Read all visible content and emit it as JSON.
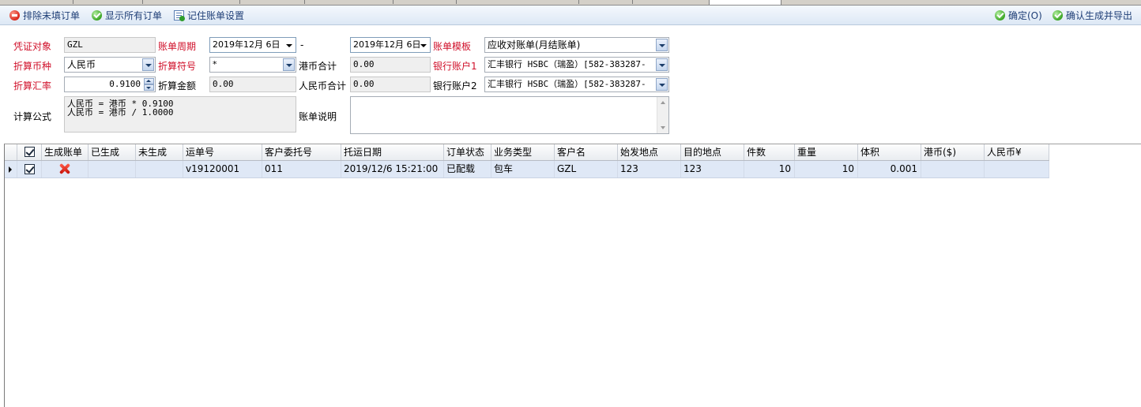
{
  "toolbar": {
    "exclude_unfilled_label": "排除未填订单",
    "show_all_label": "显示所有订单",
    "remember_settings_label": "记住账单设置",
    "ok_label": "确定(O)",
    "confirm_export_label": "确认生成并导出"
  },
  "form": {
    "voucher_target_label": "凭证对象",
    "voucher_target_value": "GZL",
    "bill_period_label": "账单周期",
    "period_start": "2019年12月 6日",
    "period_separator": "-",
    "period_end": "2019年12月 6日",
    "bill_template_label": "账单模板",
    "bill_template_value": "应收对账单(月结账单)",
    "conv_currency_label": "折算币种",
    "conv_currency_value": "人民币",
    "conv_symbol_label": "折算符号",
    "conv_symbol_value": "*",
    "hkd_total_label": "港币合计",
    "hkd_total_value": "0.00",
    "bank_account1_label": "银行账户1",
    "bank_account1_value": "汇丰银行 HSBC（瑞盈）[582-383287-",
    "conv_rate_label": "折算汇率",
    "conv_rate_value": "0.9100",
    "conv_amount_label": "折算金额",
    "conv_amount_value": "0.00",
    "rmb_total_label": "人民币合计",
    "rmb_total_value": "0.00",
    "bank_account2_label": "银行账户2",
    "bank_account2_value": "汇丰银行 HSBC（瑞盈）[582-383287-",
    "formula_label": "计算公式",
    "formula_lines": [
      "人民币 = 港币 * 0.9100",
      "人民币 = 港币 / 1.0000"
    ],
    "bill_note_label": "账单说明",
    "bill_note_value": ""
  },
  "grid": {
    "columns": [
      "生成账单",
      "已生成",
      "未生成",
      "运单号",
      "客户委托号",
      "托运日期",
      "订单状态",
      "业务类型",
      "客户名",
      "始发地点",
      "目的地点",
      "件数",
      "重量",
      "体积",
      "港币($)",
      "人民币¥"
    ],
    "rows": [
      {
        "checked": true,
        "generate": "x-icon",
        "generated": "",
        "not_generated": "",
        "waybill_no": "v19120001",
        "client_ref": "011",
        "ship_date": "2019/12/6 15:21:00",
        "order_status": "已配载",
        "business_type": "包车",
        "customer": "GZL",
        "origin": "123",
        "destination": "123",
        "pieces": "10",
        "weight": "10",
        "volume": "0.001",
        "hkd": "",
        "rmb": ""
      }
    ]
  },
  "colors": {
    "required_label": "#d0102a",
    "toolbar_text": "#1f3f77",
    "selected_row": "#dfe8f6"
  }
}
